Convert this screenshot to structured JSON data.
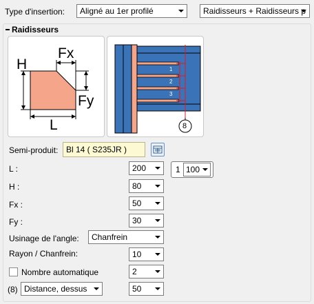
{
  "insertion": {
    "label": "Type d'insertion:",
    "align_value": "Aligné au 1er profilé",
    "type_value": "Raidisseurs + Raidisseurs p"
  },
  "group": {
    "title": "Raidisseurs"
  },
  "sketch": {
    "h": "H",
    "fx": "Fx",
    "fy": "Fy",
    "l": "L"
  },
  "detail": {
    "n1": "1",
    "n2": "2",
    "n3": "3",
    "n8": "8"
  },
  "semi": {
    "label": "Semi-produit:",
    "value": "Bl 14  ( S235JR )"
  },
  "fields": {
    "l_label": "L :",
    "l_value": "200",
    "h_label": "H :",
    "h_value": "80",
    "fx_label": "Fx :",
    "fx_value": "50",
    "fy_label": "Fy :",
    "fy_value": "30"
  },
  "ratio": {
    "prefix": "1",
    "value": "100"
  },
  "angle": {
    "label": "Usinage de l'angle:",
    "value": "Chanfrein"
  },
  "radius": {
    "label": "Rayon / Chanfrein:",
    "value": "10"
  },
  "auto": {
    "label": "Nombre automatique",
    "value": "2",
    "checked": false
  },
  "distance": {
    "prefix": "(8)",
    "type_value": "Distance, dessus",
    "value": "50"
  },
  "colors": {
    "plate_fill": "#f4a58a",
    "profile_blue": "#3b73b9",
    "dim_red": "#e11b1b"
  }
}
